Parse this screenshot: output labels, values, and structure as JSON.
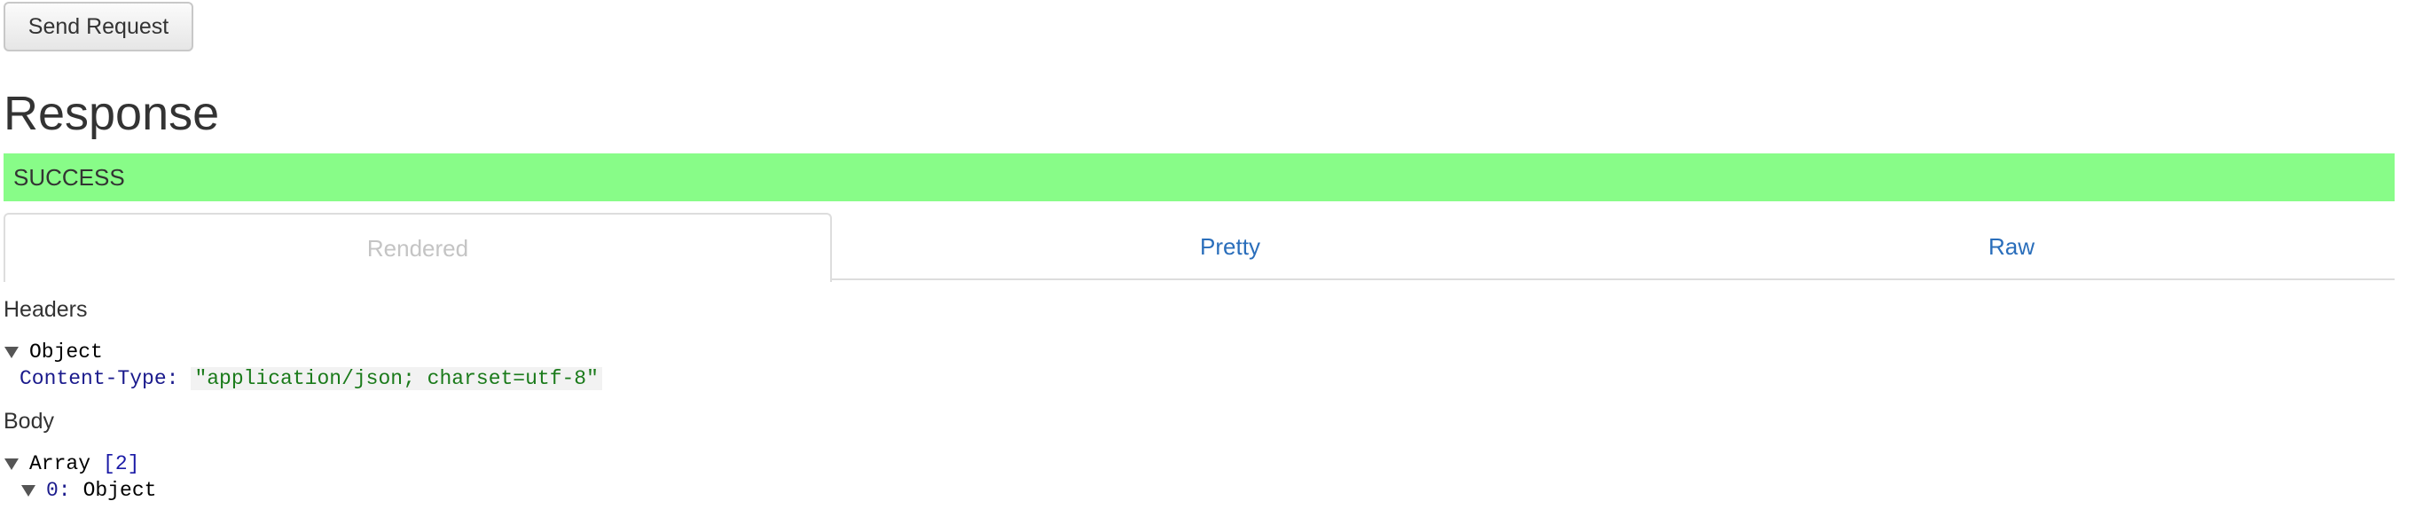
{
  "toolbar": {
    "send_label": "Send Request"
  },
  "response": {
    "title": "Response",
    "status": "SUCCESS",
    "status_color": "#88fc88"
  },
  "tabs": [
    {
      "label": "Rendered",
      "active": true
    },
    {
      "label": "Pretty",
      "active": false
    },
    {
      "label": "Raw",
      "active": false
    }
  ],
  "headers": {
    "label": "Headers",
    "type": "Object",
    "entries": [
      {
        "key": "Content-Type:",
        "value": "\"application/json; charset=utf-8\""
      }
    ]
  },
  "body": {
    "label": "Body",
    "type": "Array",
    "count": "[2]",
    "first_item": {
      "key": "0:",
      "type": "Object"
    }
  },
  "colors": {
    "link": "#2a6ebb",
    "inactive_tab_text": "#c4c4c4",
    "string_value": "#1a7a1a",
    "json_key": "#1a1a8c"
  }
}
